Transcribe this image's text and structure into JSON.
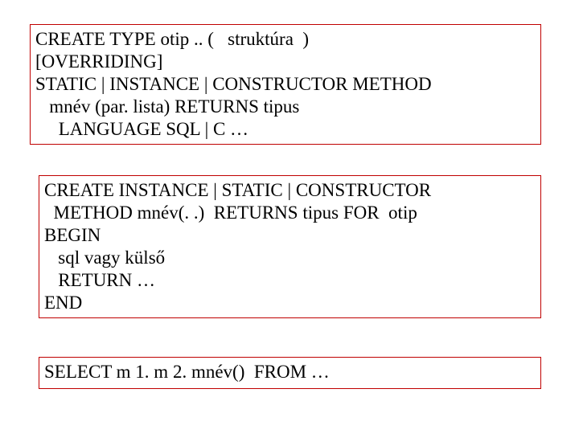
{
  "box1": {
    "l1": "CREATE TYPE otip .. (   struktúra  )",
    "l2": "[OVERRIDING]",
    "l3": "STATIC | INSTANCE | CONSTRUCTOR METHOD",
    "l4": "   mnév (par. lista) RETURNS tipus",
    "l5": "     LANGUAGE SQL | C …"
  },
  "box2": {
    "l1": "CREATE INSTANCE | STATIC | CONSTRUCTOR",
    "l2": "  METHOD mnév(. .)  RETURNS tipus FOR  otip",
    "l3": "BEGIN",
    "l4": "   sql vagy külső",
    "l5": "   RETURN …",
    "l6": "END"
  },
  "box3": {
    "l1": "SELECT m 1. m 2. mnév()  FROM …"
  }
}
